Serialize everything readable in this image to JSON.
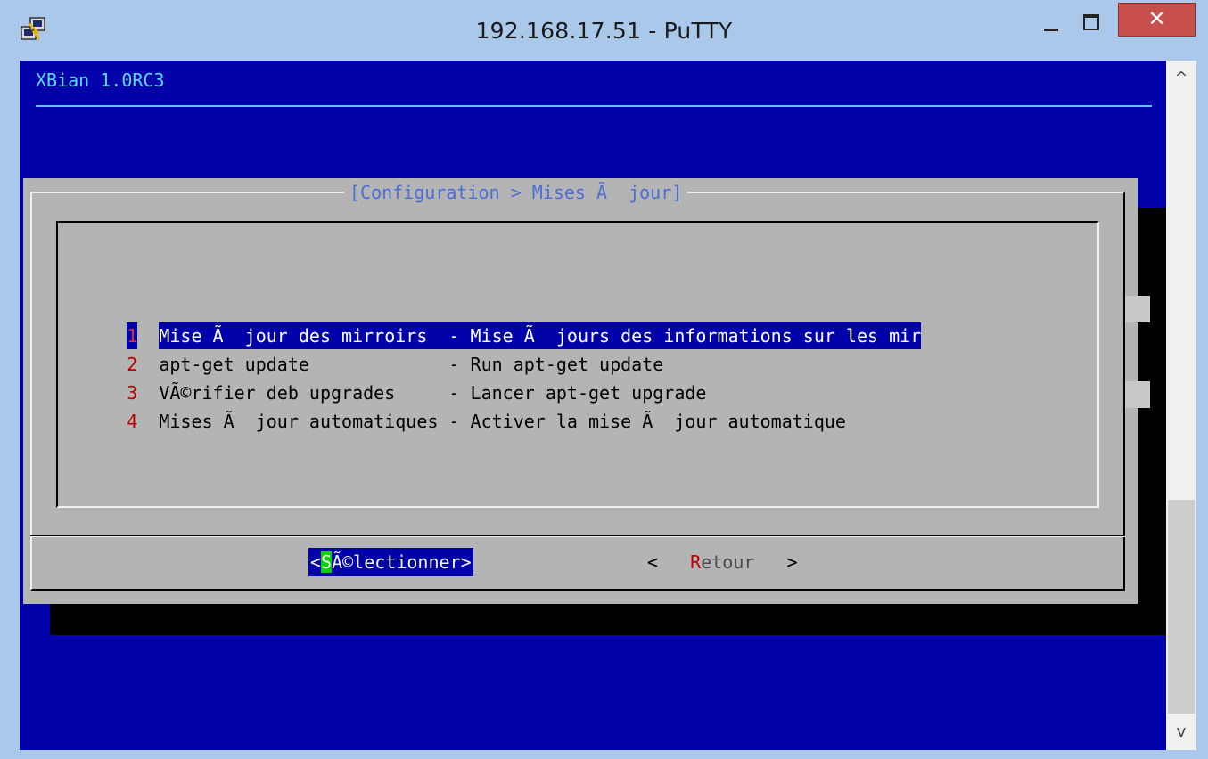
{
  "window": {
    "title": "192.168.17.51 - PuTTY",
    "close_label": "✕",
    "icon": "putty-icon"
  },
  "terminal": {
    "header": "XBian 1.0RC3",
    "dialog_title": "[Configuration > Mises Ã  jour]",
    "menu": [
      {
        "num": "1",
        "text": "Mise Ã  jour des mirroirs  - Mise Ã  jours des informations sur les mir",
        "selected": true
      },
      {
        "num": "2",
        "text": "apt-get update             - Run apt-get update",
        "selected": false
      },
      {
        "num": "3",
        "text": "VÃ©rifier deb upgrades     - Lancer apt-get upgrade",
        "selected": false
      },
      {
        "num": "4",
        "text": "Mises Ã  jour automatiques - Activer la mise Ã  jour automatique",
        "selected": false
      }
    ],
    "buttons": {
      "select_open": "<",
      "select_hot": "S",
      "select_rest": "Ã©lectionner>",
      "back_open": "<   ",
      "back_hot": "R",
      "back_rest": "etour",
      "back_close": "   >"
    }
  },
  "scrollbar": {
    "up_icon": "^",
    "down_icon": "v"
  },
  "colors": {
    "terminal_bg": "#0101a9",
    "dialog_bg": "#b4b4b4",
    "title_bar": "#a9c8ea",
    "close_button": "#c7504c",
    "hotkey_green": "#00d400",
    "hotkey_red": "#c00000"
  }
}
